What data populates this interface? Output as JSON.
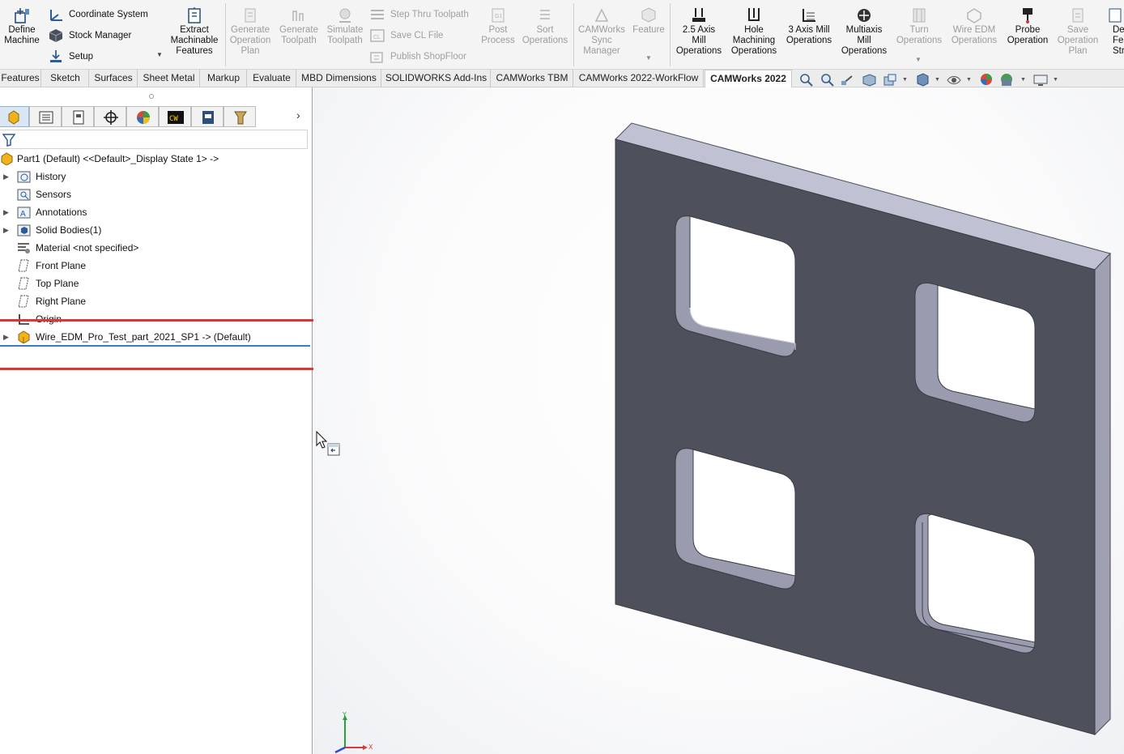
{
  "ribbon": {
    "define_machine": "Define\nMachine",
    "coordinate_system": "Coordinate System",
    "stock_manager": "Stock Manager",
    "setup": "Setup",
    "extract_features": "Extract\nMachinable\nFeatures",
    "generate_plan": "Generate\nOperation\nPlan",
    "generate_toolpath": "Generate\nToolpath",
    "simulate_toolpath": "Simulate\nToolpath",
    "step_thru": "Step Thru Toolpath",
    "save_cl": "Save CL File",
    "publish_shopfloor": "Publish ShopFloor",
    "post_process": "Post\nProcess",
    "sort_operations": "Sort\nOperations",
    "camworks_sync": "CAMWorks\nSync\nManager",
    "feature": "Feature",
    "mill_25": "2.5 Axis\nMill\nOperations",
    "hole_machining": "Hole\nMachining\nOperations",
    "mill_3axis": "3 Axis Mill\nOperations",
    "multiaxis": "Multiaxis\nMill\nOperations",
    "turn_ops": "Turn\nOperations",
    "wire_edm": "Wire EDM\nOperations",
    "probe": "Probe\nOperation",
    "save_plan": "Save\nOperation\nPlan",
    "cut_off": "De\nFea\nStra"
  },
  "tabs": [
    "Features",
    "Sketch",
    "Surfaces",
    "Sheet Metal",
    "Markup",
    "Evaluate",
    "MBD Dimensions",
    "SOLIDWORKS Add-Ins",
    "CAMWorks TBM",
    "CAMWorks 2022-WorkFlow",
    "CAMWorks 2022"
  ],
  "active_tab": "CAMWorks 2022",
  "tree": {
    "root": "Part1 (Default) <<Default>_Display State 1> ->",
    "items": [
      {
        "label": "History"
      },
      {
        "label": "Sensors"
      },
      {
        "label": "Annotations"
      },
      {
        "label": "Solid Bodies(1)"
      },
      {
        "label": "Material <not specified>"
      },
      {
        "label": "Front Plane"
      },
      {
        "label": "Top Plane"
      },
      {
        "label": "Right Plane"
      },
      {
        "label": "Origin"
      },
      {
        "label": "Wire_EDM_Pro_Test_part_2021_SP1 -> (Default)"
      }
    ]
  },
  "axes": {
    "x": "X",
    "y": "Y"
  },
  "colors": {
    "highlight": "#d9373a",
    "part_face": "#4e515c",
    "part_edge": "#b9bac8",
    "selection_line": "#3a7fc1"
  }
}
